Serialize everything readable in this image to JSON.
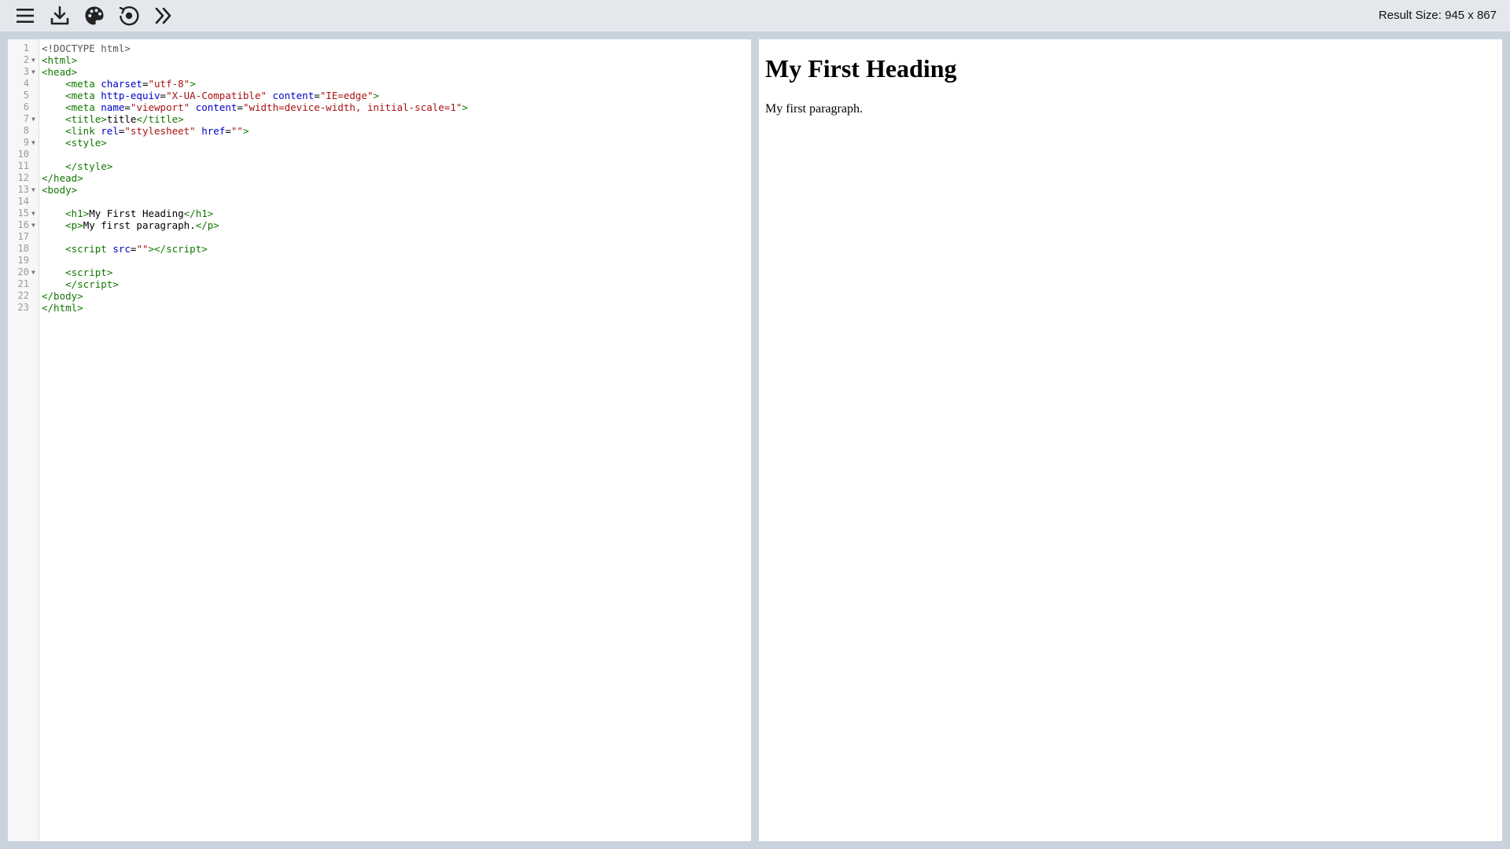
{
  "toolbar": {
    "buttons": [
      {
        "icon": "hamburger-menu-icon"
      },
      {
        "icon": "download-icon"
      },
      {
        "icon": "palette-icon"
      },
      {
        "icon": "refresh-icon"
      },
      {
        "icon": "double-chevron-right-icon"
      }
    ],
    "result_size_label": "Result Size: 945 x 867"
  },
  "editor": {
    "lines": [
      {
        "n": "1",
        "fold": false,
        "html": "<span class=\"mt\">&lt;!DOCTYPE html&gt;</span>"
      },
      {
        "n": "2",
        "fold": true,
        "html": "<span class=\"tg\">&lt;html&gt;</span>"
      },
      {
        "n": "3",
        "fold": true,
        "html": "<span class=\"tg\">&lt;head&gt;</span>"
      },
      {
        "n": "4",
        "fold": false,
        "html": "    <span class=\"tg\">&lt;meta</span> <span class=\"at\">charset</span>=<span class=\"st\">\"utf-8\"</span><span class=\"tg\">&gt;</span>"
      },
      {
        "n": "5",
        "fold": false,
        "html": "    <span class=\"tg\">&lt;meta</span> <span class=\"at\">http-equiv</span>=<span class=\"st\">\"X-UA-Compatible\"</span> <span class=\"at\">content</span>=<span class=\"st\">\"IE=edge\"</span><span class=\"tg\">&gt;</span>"
      },
      {
        "n": "6",
        "fold": false,
        "html": "    <span class=\"tg\">&lt;meta</span> <span class=\"at\">name</span>=<span class=\"st\">\"viewport\"</span> <span class=\"at\">content</span>=<span class=\"st\">\"width=device-width, initial-scale=1\"</span><span class=\"tg\">&gt;</span>"
      },
      {
        "n": "7",
        "fold": true,
        "html": "    <span class=\"tg\">&lt;title&gt;</span>title<span class=\"tg\">&lt;/title&gt;</span>"
      },
      {
        "n": "8",
        "fold": false,
        "html": "    <span class=\"tg\">&lt;link</span> <span class=\"at\">rel</span>=<span class=\"st\">\"stylesheet\"</span> <span class=\"at\">href</span>=<span class=\"st\">\"\"</span><span class=\"tg\">&gt;</span>"
      },
      {
        "n": "9",
        "fold": true,
        "html": "    <span class=\"tg\">&lt;style&gt;</span>"
      },
      {
        "n": "10",
        "fold": false,
        "html": ""
      },
      {
        "n": "11",
        "fold": false,
        "html": "    <span class=\"tg\">&lt;/style&gt;</span>"
      },
      {
        "n": "12",
        "fold": false,
        "html": "<span class=\"tg\">&lt;/head&gt;</span>"
      },
      {
        "n": "13",
        "fold": true,
        "html": "<span class=\"tg\">&lt;body&gt;</span>"
      },
      {
        "n": "14",
        "fold": false,
        "html": ""
      },
      {
        "n": "15",
        "fold": true,
        "html": "    <span class=\"tg\">&lt;h1&gt;</span>My First Heading<span class=\"tg\">&lt;/h1&gt;</span>"
      },
      {
        "n": "16",
        "fold": true,
        "html": "    <span class=\"tg\">&lt;p&gt;</span>My first paragraph.<span class=\"tg\">&lt;/p&gt;</span>"
      },
      {
        "n": "17",
        "fold": false,
        "html": ""
      },
      {
        "n": "18",
        "fold": false,
        "html": "    <span class=\"tg\">&lt;script</span> <span class=\"at\">src</span>=<span class=\"st\">\"\"</span><span class=\"tg\">&gt;&lt;/script&gt;</span>"
      },
      {
        "n": "19",
        "fold": false,
        "html": ""
      },
      {
        "n": "20",
        "fold": true,
        "html": "    <span class=\"tg\">&lt;script&gt;</span>"
      },
      {
        "n": "21",
        "fold": false,
        "html": "    <span class=\"tg\">&lt;/script&gt;</span>"
      },
      {
        "n": "22",
        "fold": false,
        "html": "<span class=\"tg\">&lt;/body&gt;</span>"
      },
      {
        "n": "23",
        "fold": false,
        "html": "<span class=\"tg\">&lt;/html&gt;</span>"
      }
    ]
  },
  "result": {
    "heading": "My First Heading",
    "paragraph": "My first paragraph."
  }
}
